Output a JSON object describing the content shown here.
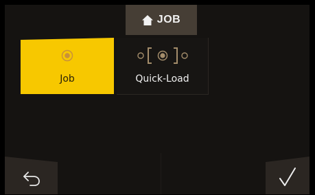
{
  "header": {
    "title": "JOB",
    "icon": "home-icon"
  },
  "tiles": [
    {
      "label": "Job",
      "icon": "target-icon",
      "selected": true
    },
    {
      "label": "Quick-Load",
      "icon": "quick-load-icon",
      "selected": false
    }
  ],
  "footer": {
    "back_icon": "back-arrow-icon",
    "confirm_icon": "checkmark-icon"
  },
  "colors": {
    "accent": "#f7c800",
    "header_bg": "#463e35",
    "screen_bg": "#151311",
    "icon_tan": "#a48d6b"
  }
}
